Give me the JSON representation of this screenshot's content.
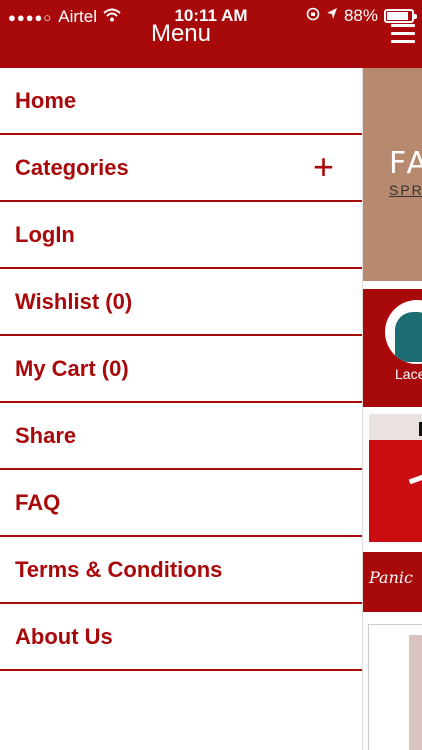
{
  "status_bar": {
    "carrier": "Airtel",
    "time": "10:11 AM",
    "battery": "88%",
    "battery_level": 0.88
  },
  "header": {
    "title": "Menu"
  },
  "menu": {
    "items": [
      {
        "label": "Home"
      },
      {
        "label": "Categories",
        "expand": "+"
      },
      {
        "label": "LogIn"
      },
      {
        "label": "Wishlist (0)"
      },
      {
        "label": "My Cart (0)"
      },
      {
        "label": "Share"
      },
      {
        "label": "FAQ"
      },
      {
        "label": "Terms & Conditions"
      },
      {
        "label": "About Us"
      }
    ]
  },
  "panel": {
    "banner_text": "FA",
    "banner_sub": "SPR",
    "category_label": "Lace",
    "promo_text": "Panic"
  },
  "colors": {
    "brand_red": "#a8090b",
    "banner_tan": "#b7896f"
  }
}
